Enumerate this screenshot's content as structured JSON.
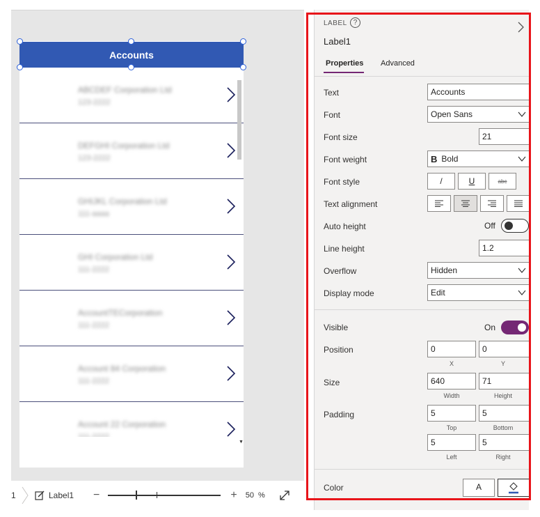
{
  "canvas": {
    "header_title": "Accounts",
    "gallery_rows": [
      {
        "name": "ABCDEF Corporation Ltd",
        "sub": "123-2222"
      },
      {
        "name": "DEFGHI Corporation Ltd",
        "sub": "123-2222"
      },
      {
        "name": "GHIJKL Corporation Ltd",
        "sub": "111-aaaa"
      },
      {
        "name": "GHI Corporation Ltd",
        "sub": "111-2222"
      },
      {
        "name": "AccountTECorporation",
        "sub": "111-2222"
      },
      {
        "name": "Account 84 Corporation",
        "sub": "111-2222"
      },
      {
        "name": "Account 22 Corporation",
        "sub": "111-2222"
      }
    ]
  },
  "status_bar": {
    "crumb_index": "1",
    "selected_control": "Label1",
    "zoom_minus": "−",
    "zoom_plus": "+",
    "zoom_value": "50",
    "zoom_unit": "%",
    "zoom_level_percent": 50
  },
  "panel": {
    "control_type": "LABEL",
    "help": "?",
    "control_name": "Label1",
    "tabs": {
      "properties": "Properties",
      "advanced": "Advanced"
    },
    "properties": {
      "text": {
        "label": "Text",
        "value": "Accounts"
      },
      "font": {
        "label": "Font",
        "value": "Open Sans"
      },
      "font_size": {
        "label": "Font size",
        "value": "21"
      },
      "font_weight": {
        "label": "Font weight",
        "value": "Bold",
        "icon": "B"
      },
      "font_style": {
        "label": "Font style",
        "italic": "/",
        "underline": "U",
        "strike": "abc"
      },
      "text_alignment": {
        "label": "Text alignment",
        "selected": "center"
      },
      "auto_height": {
        "label": "Auto height",
        "state": "Off"
      },
      "line_height": {
        "label": "Line height",
        "value": "1.2"
      },
      "overflow": {
        "label": "Overflow",
        "value": "Hidden"
      },
      "display_mode": {
        "label": "Display mode",
        "value": "Edit"
      },
      "visible": {
        "label": "Visible",
        "state": "On"
      },
      "position": {
        "label": "Position",
        "x": "0",
        "y": "0",
        "x_cap": "X",
        "y_cap": "Y"
      },
      "size": {
        "label": "Size",
        "width": "640",
        "height": "71",
        "width_cap": "Width",
        "height_cap": "Height"
      },
      "padding": {
        "label": "Padding",
        "top": "5",
        "bottom": "5",
        "left": "5",
        "right": "5",
        "top_cap": "Top",
        "bottom_cap": "Bottom",
        "left_cap": "Left",
        "right_cap": "Right"
      },
      "color": {
        "label": "Color",
        "text_color_glyph": "A"
      }
    }
  },
  "colors": {
    "header_blue": "#3159b3",
    "accent_purple": "#742774",
    "highlight_red": "#e8141a",
    "chevron_navy": "#1a1f5c"
  }
}
